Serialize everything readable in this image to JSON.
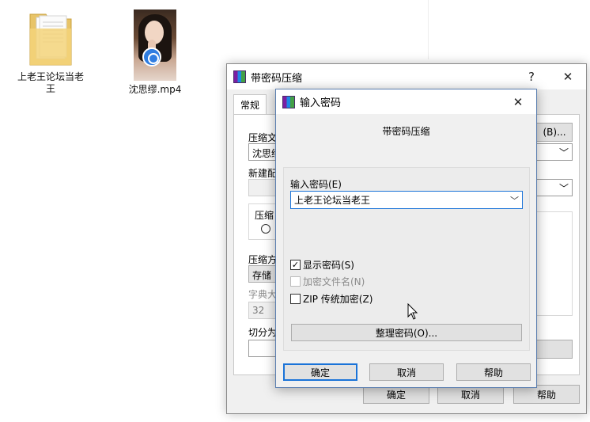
{
  "desktop": {
    "folder_label": "上老王论坛当老王",
    "video_label": "沈思缪.mp4"
  },
  "back_window": {
    "title": "带密码压缩",
    "help_glyph": "?",
    "close_glyph": "✕",
    "tab_general": "常规",
    "archive_name_label": "压缩文",
    "archive_name_value": "沈思缪",
    "browse_button": "(B)...",
    "profile_label": "新建配",
    "format_group_label": "压缩",
    "method_label": "压缩方",
    "method_value": "存储",
    "dict_label": "字典大",
    "dict_value": "32",
    "split_label": "切分为",
    "ok": "确定",
    "cancel": "取消",
    "help": "帮助"
  },
  "dialog": {
    "title": "输入密码",
    "close_glyph": "✕",
    "heading": "带密码压缩",
    "password_label": "输入密码(E)",
    "password_value": "上老王论坛当老王",
    "dropdown_glyph": "﹀",
    "show_password": "显示密码(S)",
    "show_password_checked": true,
    "encrypt_names": "加密文件名(N)",
    "encrypt_names_enabled": false,
    "zip_legacy": "ZIP 传统加密(Z)",
    "zip_legacy_checked": false,
    "organize_button": "整理密码(O)...",
    "ok": "确定",
    "cancel": "取消",
    "help": "帮助",
    "check_glyph": "✓"
  },
  "colors": {
    "accent": "#1a73d8"
  }
}
